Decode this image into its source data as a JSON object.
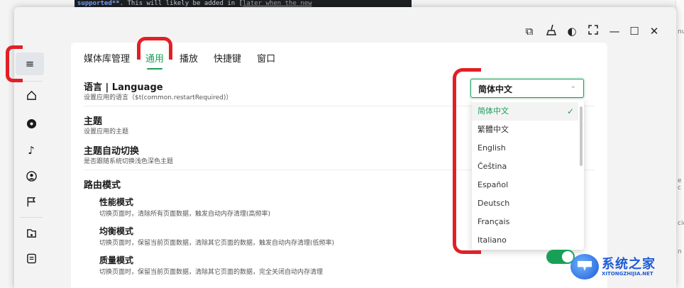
{
  "background": {
    "editor_text_bold": "supported**",
    "editor_text": ". This will likely be added in [",
    "editor_link": "later when the new",
    "right_snippets": [
      "nu",
      "e c",
      "cid",
      "n"
    ]
  },
  "titlebar": {
    "icons": [
      "picture-in-picture-icon",
      "broom-icon",
      "contrast-icon",
      "fullscreen-icon",
      "minimize-icon",
      "maximize-icon",
      "close-icon"
    ],
    "glyphs": [
      "⧉",
      "🧹",
      "◐",
      "⛶",
      "—",
      "☐",
      "✕"
    ]
  },
  "sidebar": {
    "items": [
      {
        "name": "menu-icon",
        "glyph": "≡"
      },
      {
        "name": "home-icon",
        "glyph": "⌂"
      },
      {
        "name": "disc-icon",
        "glyph": "◉"
      },
      {
        "name": "music-note-icon",
        "glyph": "♪"
      },
      {
        "name": "user-circle-icon",
        "glyph": "☺"
      },
      {
        "name": "flag-icon",
        "glyph": "⚐"
      },
      {
        "name": "folder-music-icon",
        "glyph": "⬢"
      },
      {
        "name": "lyrics-icon",
        "glyph": "▤"
      }
    ]
  },
  "tabs": [
    "媒体库管理",
    "通用",
    "播放",
    "快捷键",
    "窗口"
  ],
  "settings": {
    "language": {
      "title": "语言 | Language",
      "desc": "设置应用的语言（$t(common.restartRequired)）"
    },
    "theme": {
      "title": "主题",
      "desc": "设置应用的主题"
    },
    "auto_theme": {
      "title": "主题自动切换",
      "desc": "是否跟随系统切换浅色深色主题"
    },
    "route": {
      "title": "路由模式"
    },
    "performance": {
      "title": "性能模式",
      "desc": "切换页面时，清除所有页面数据，触发自动内存清理(高频率)"
    },
    "balanced": {
      "title": "均衡模式",
      "desc": "切换页面时，保留当前页面数据，清除其它页面的数据，触发自动内存清理(低频率)"
    },
    "quality": {
      "title": "质量模式",
      "desc": "切换页面时，保留当前页面数据，清除其它页面的数据，完全关闭自动内存清理"
    }
  },
  "language_select": {
    "value": "简体中文",
    "options": [
      "简体中文",
      "繁體中文",
      "English",
      "Čeština",
      "Español",
      "Deutsch",
      "Français",
      "Italiano"
    ],
    "selected_index": 0
  },
  "watermark": {
    "text": "系统之家",
    "sub": "XITONGZHIJIA.NET"
  },
  "colors": {
    "accent": "#18a058",
    "annotation": "#e21f26",
    "watermark": "#1d5bd6"
  }
}
